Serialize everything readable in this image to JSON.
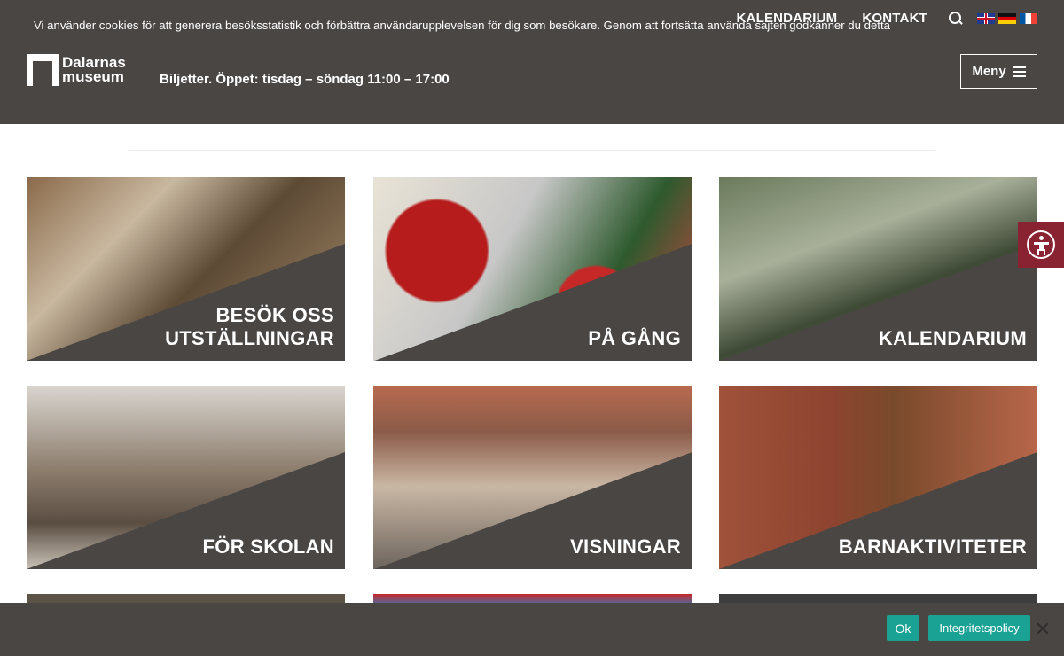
{
  "header": {
    "nav": [
      "KALENDARIUM",
      "KONTAKT"
    ],
    "logo_line1": "Dalarnas",
    "logo_line2": "museum",
    "tagline": "Biljetter. Öppet: tisdag – söndag 11:00 – 17:00",
    "menu_label": "Meny",
    "flags": [
      "english-flag-icon",
      "german-flag-icon",
      "french-flag-icon"
    ]
  },
  "tiles": [
    {
      "line1": "BESÖK OSS",
      "line2": "UTSTÄLLNINGAR"
    },
    {
      "line1": "",
      "line2": "PÅ GÅNG"
    },
    {
      "line1": "",
      "line2": "KALENDARIUM"
    },
    {
      "line1": "",
      "line2": "FÖR SKOLAN"
    },
    {
      "line1": "",
      "line2": "VISNINGAR"
    },
    {
      "line1": "",
      "line2": "BARNAKTIVITETER"
    }
  ],
  "cookie": {
    "text": "Vi använder cookies för att generera besöksstatistik och förbättra användarupplevelsen för dig som besökare. Genom att fortsätta använda sajten godkänner du detta",
    "ok_label": "Ok",
    "policy_label": "Integritetspolicy"
  },
  "colors": {
    "header_bg": "#4a4644",
    "band": "#4a4644",
    "accent": "#1aa294",
    "accessibility": "#8a2331"
  }
}
